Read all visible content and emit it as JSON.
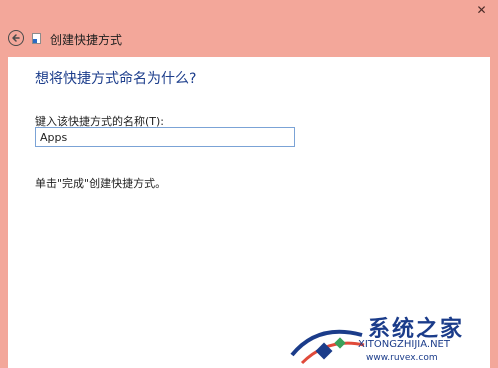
{
  "window": {
    "close_glyph": "✕"
  },
  "titlebar": {
    "title": "创建快捷方式"
  },
  "main": {
    "heading": "想将快捷方式命名为什么?",
    "name_label": "键入该快捷方式的名称(T):",
    "name_value": "Apps",
    "instruction": "单击\"完成\"创建快捷方式。"
  },
  "watermark": {
    "title": "系统之家",
    "subtitle": "XITONGZHIJIA.NET",
    "url": "www.ruvex.com"
  },
  "colors": {
    "background": "#f3a79a",
    "heading": "#1d3e8c",
    "input_border": "#7ba3d6",
    "watermark": "#1b3c8a"
  }
}
